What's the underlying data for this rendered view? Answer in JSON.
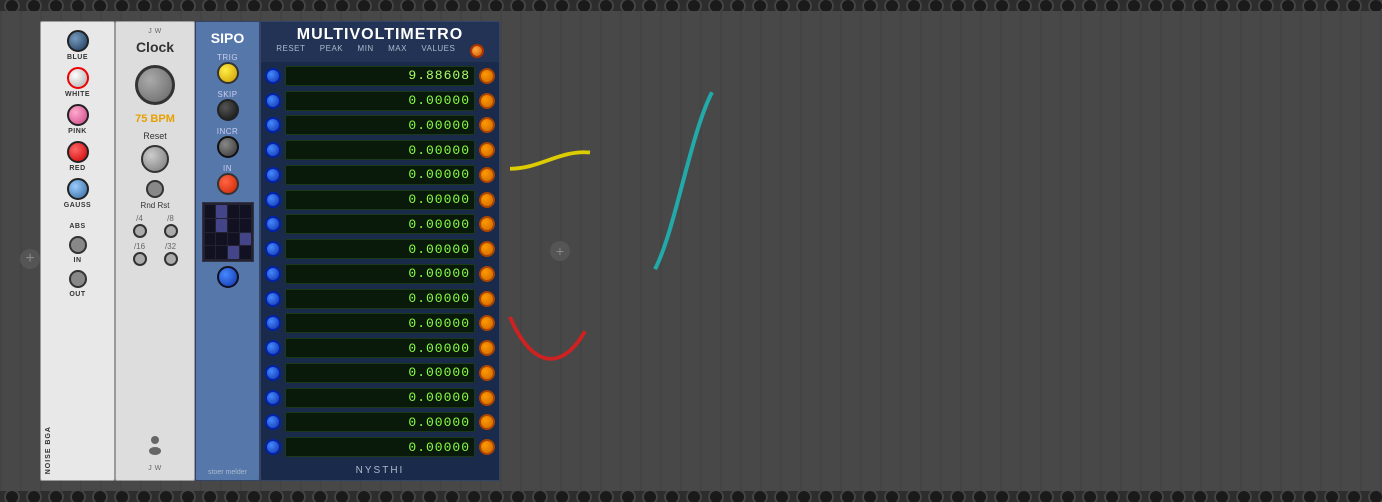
{
  "rack": {
    "background_color": "#4a4a4a"
  },
  "modules": {
    "noise": {
      "title": "NOISE BGA",
      "labels": {
        "blue": "BLUE",
        "white": "WHITE",
        "pink": "PINK",
        "red": "RED",
        "gauss": "GAUSS",
        "abs": "ABS",
        "in": "IN",
        "out": "OUT"
      }
    },
    "clock": {
      "brand": "J W",
      "title": "Clock",
      "bpm": "75 BPM",
      "reset_label": "Reset",
      "rnd_rst_label": "Rnd Rst",
      "dividers": [
        "/4",
        "/8",
        "/16",
        "/32"
      ]
    },
    "sipo": {
      "title": "SIPO",
      "sections": {
        "trig": "TRIG",
        "skip": "SKIP",
        "incr": "INCR",
        "in": "IN"
      },
      "brand": "stoer melder"
    },
    "multivoltimetro": {
      "title": "MULTIVOLTIMETRO",
      "subtitle_labels": [
        "RESET",
        "PEAK",
        "MIN",
        "MAX",
        "VALUES"
      ],
      "rows": [
        {
          "value": "9.88608"
        },
        {
          "value": "0.00000"
        },
        {
          "value": "0.00000"
        },
        {
          "value": "0.00000"
        },
        {
          "value": "0.00000"
        },
        {
          "value": "0.00000"
        },
        {
          "value": "0.00000"
        },
        {
          "value": "0.00000"
        },
        {
          "value": "0.00000"
        },
        {
          "value": "0.00000"
        },
        {
          "value": "0.00000"
        },
        {
          "value": "0.00000"
        },
        {
          "value": "0.00000"
        },
        {
          "value": "0.00000"
        },
        {
          "value": "0.00000"
        },
        {
          "value": "0.00000"
        }
      ],
      "brand": "NYSTHI"
    }
  },
  "ui": {
    "add_button": "+",
    "perf_count": 80
  }
}
